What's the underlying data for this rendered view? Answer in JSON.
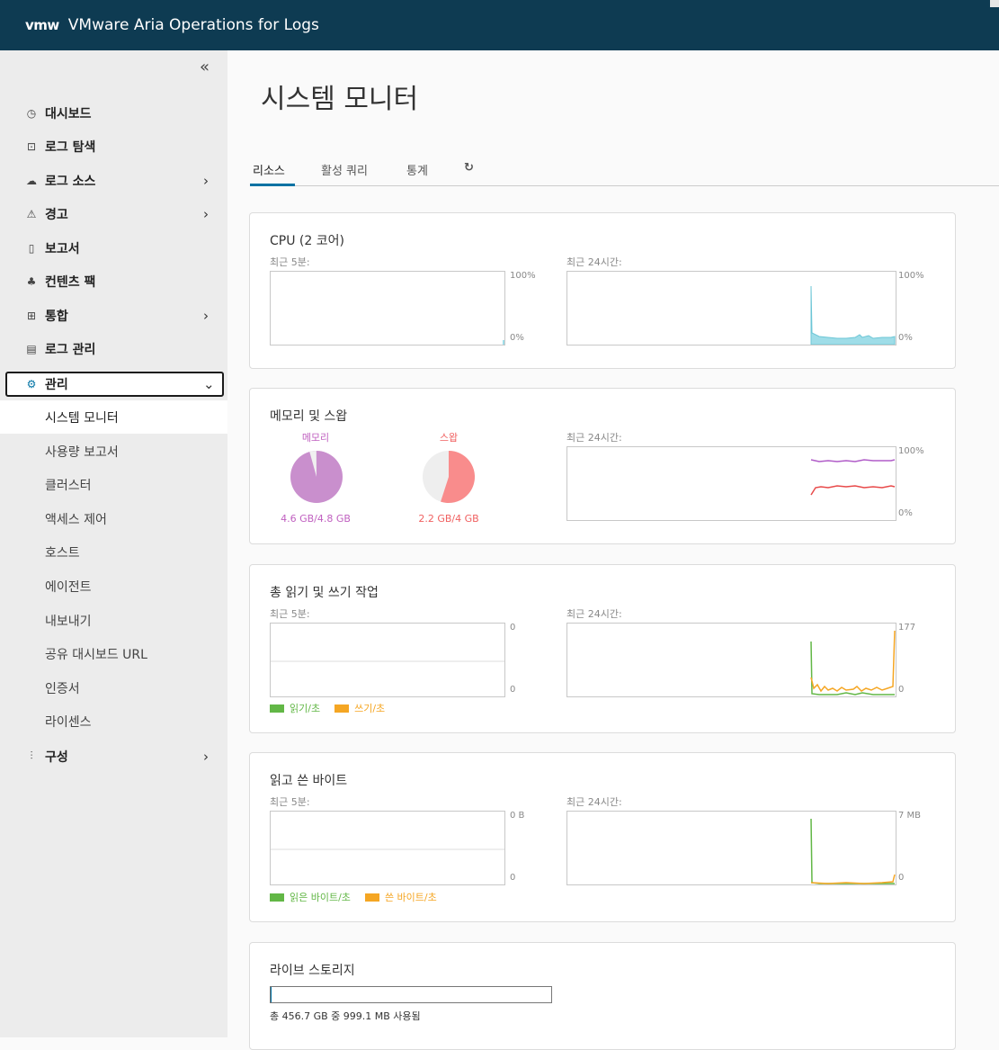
{
  "header": {
    "logo": "vmw",
    "title": "VMware Aria Operations for Logs"
  },
  "sidebar": {
    "collapse_glyph": "«",
    "items": [
      {
        "label": "대시보드",
        "icon": "dashboard-icon"
      },
      {
        "label": "로그 탐색",
        "icon": "explore-logs-icon"
      },
      {
        "label": "로그 소스",
        "icon": "cloud-icon",
        "expandable": true
      },
      {
        "label": "경고",
        "icon": "warning-icon",
        "expandable": true
      },
      {
        "label": "보고서",
        "icon": "report-icon"
      },
      {
        "label": "컨텐츠 팩",
        "icon": "content-pack-icon"
      },
      {
        "label": "통합",
        "icon": "integration-icon",
        "expandable": true
      },
      {
        "label": "로그 관리",
        "icon": "log-management-icon"
      },
      {
        "label": "관리",
        "icon": "gear-icon",
        "expanded": true
      },
      {
        "label": "구성",
        "icon": "sliders-icon",
        "expandable": true
      }
    ],
    "admin_subitems": [
      "시스템 모니터",
      "사용량 보고서",
      "클러스터",
      "액세스 제어",
      "호스트",
      "에이전트",
      "내보내기",
      "공유 대시보드 URL",
      "인증서",
      "라이센스"
    ],
    "selected_subitem": "시스템 모니터"
  },
  "page": {
    "title": "시스템 모니터"
  },
  "tabs": [
    {
      "label": "리소스",
      "active": true
    },
    {
      "label": "활성 쿼리"
    },
    {
      "label": "통계"
    }
  ],
  "cpu": {
    "title": "CPU (2 코어)",
    "recent5_label": "최근 5분:",
    "recent24_label": "최근 24시간:",
    "y_max": "100%",
    "y_min": "0%",
    "color": "#9fdde8"
  },
  "memory": {
    "title": "메모리 및 스왑",
    "memory_label": "메모리",
    "memory_value": "4.6 GB/4.8 GB",
    "memory_fraction": 0.958,
    "memory_color": "#c98fcd",
    "swap_label": "스왑",
    "swap_value": "2.2 GB/4 GB",
    "swap_fraction": 0.55,
    "swap_color": "#f98c8c",
    "recent24_label": "최근 24시간:",
    "y_max": "100%",
    "y_min": "0%"
  },
  "io_ops": {
    "title": "총 읽기 및 쓰기 작업",
    "recent5_label": "최근 5분:",
    "recent24_label": "최근 24시간:",
    "y5_max": "0",
    "y5_min": "0",
    "y24_max": "177",
    "y24_min": "0",
    "legend_read": "읽기/초",
    "legend_write": "쓰기/초",
    "read_color": "#62b746",
    "write_color": "#f5a623"
  },
  "io_bytes": {
    "title": "읽고 쓴 바이트",
    "recent5_label": "최근 5분:",
    "recent24_label": "최근 24시간:",
    "y5_max": "0 B",
    "y5_min": "0",
    "y24_max": "7 MB",
    "y24_min": "0",
    "legend_read": "읽은 바이트/초",
    "legend_write": "쓴 바이트/초"
  },
  "storage": {
    "title": "라이브 스토리지",
    "summary": "총 456.7 GB 중 999.1 MB 사용됨",
    "used_fraction": 0.002
  }
}
